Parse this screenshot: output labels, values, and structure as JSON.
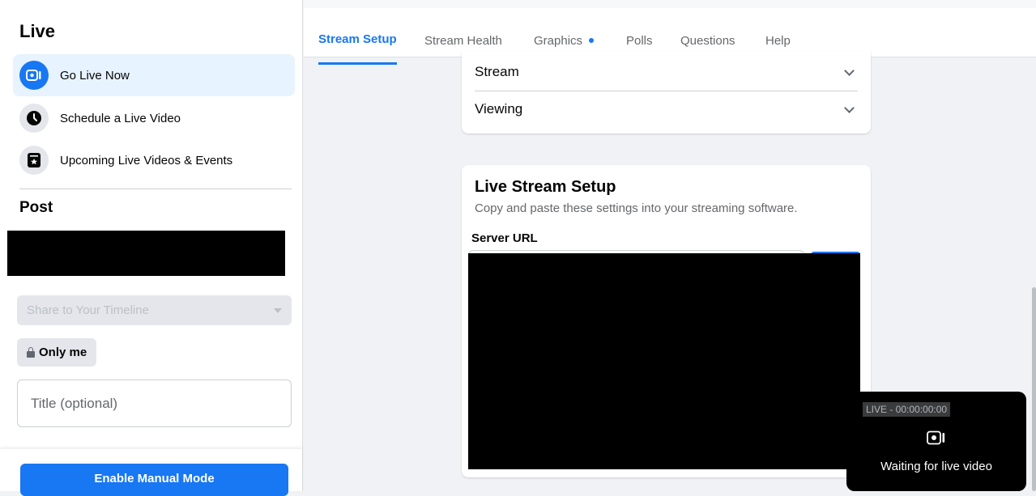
{
  "sidebar": {
    "title": "Live",
    "items": [
      {
        "label": "Go Live Now",
        "icon": "camera-icon"
      },
      {
        "label": "Schedule a Live Video",
        "icon": "clock-icon"
      },
      {
        "label": "Upcoming Live Videos & Events",
        "icon": "calendar-star-icon"
      }
    ],
    "post_title": "Post",
    "share_select": "Share to Your Timeline",
    "privacy": "Only me",
    "title_placeholder": "Title (optional)",
    "manual_button": "Enable Manual Mode"
  },
  "tabs": [
    {
      "label": "Stream Setup",
      "active": true
    },
    {
      "label": "Stream Health"
    },
    {
      "label": "Graphics",
      "has_dot": true
    },
    {
      "label": "Polls"
    },
    {
      "label": "Questions"
    },
    {
      "label": "Help"
    }
  ],
  "settings": {
    "stream_label": "Stream",
    "viewing_label": "Viewing"
  },
  "setup": {
    "title": "Live Stream Setup",
    "subtitle": "Copy and paste these settings into your streaming software.",
    "server_url_label": "Server URL"
  },
  "preview": {
    "badge": "LIVE - 00:00:00:00",
    "status": "Waiting for live video"
  },
  "colors": {
    "accent": "#1877f2",
    "active_bg": "#e7f3ff"
  }
}
